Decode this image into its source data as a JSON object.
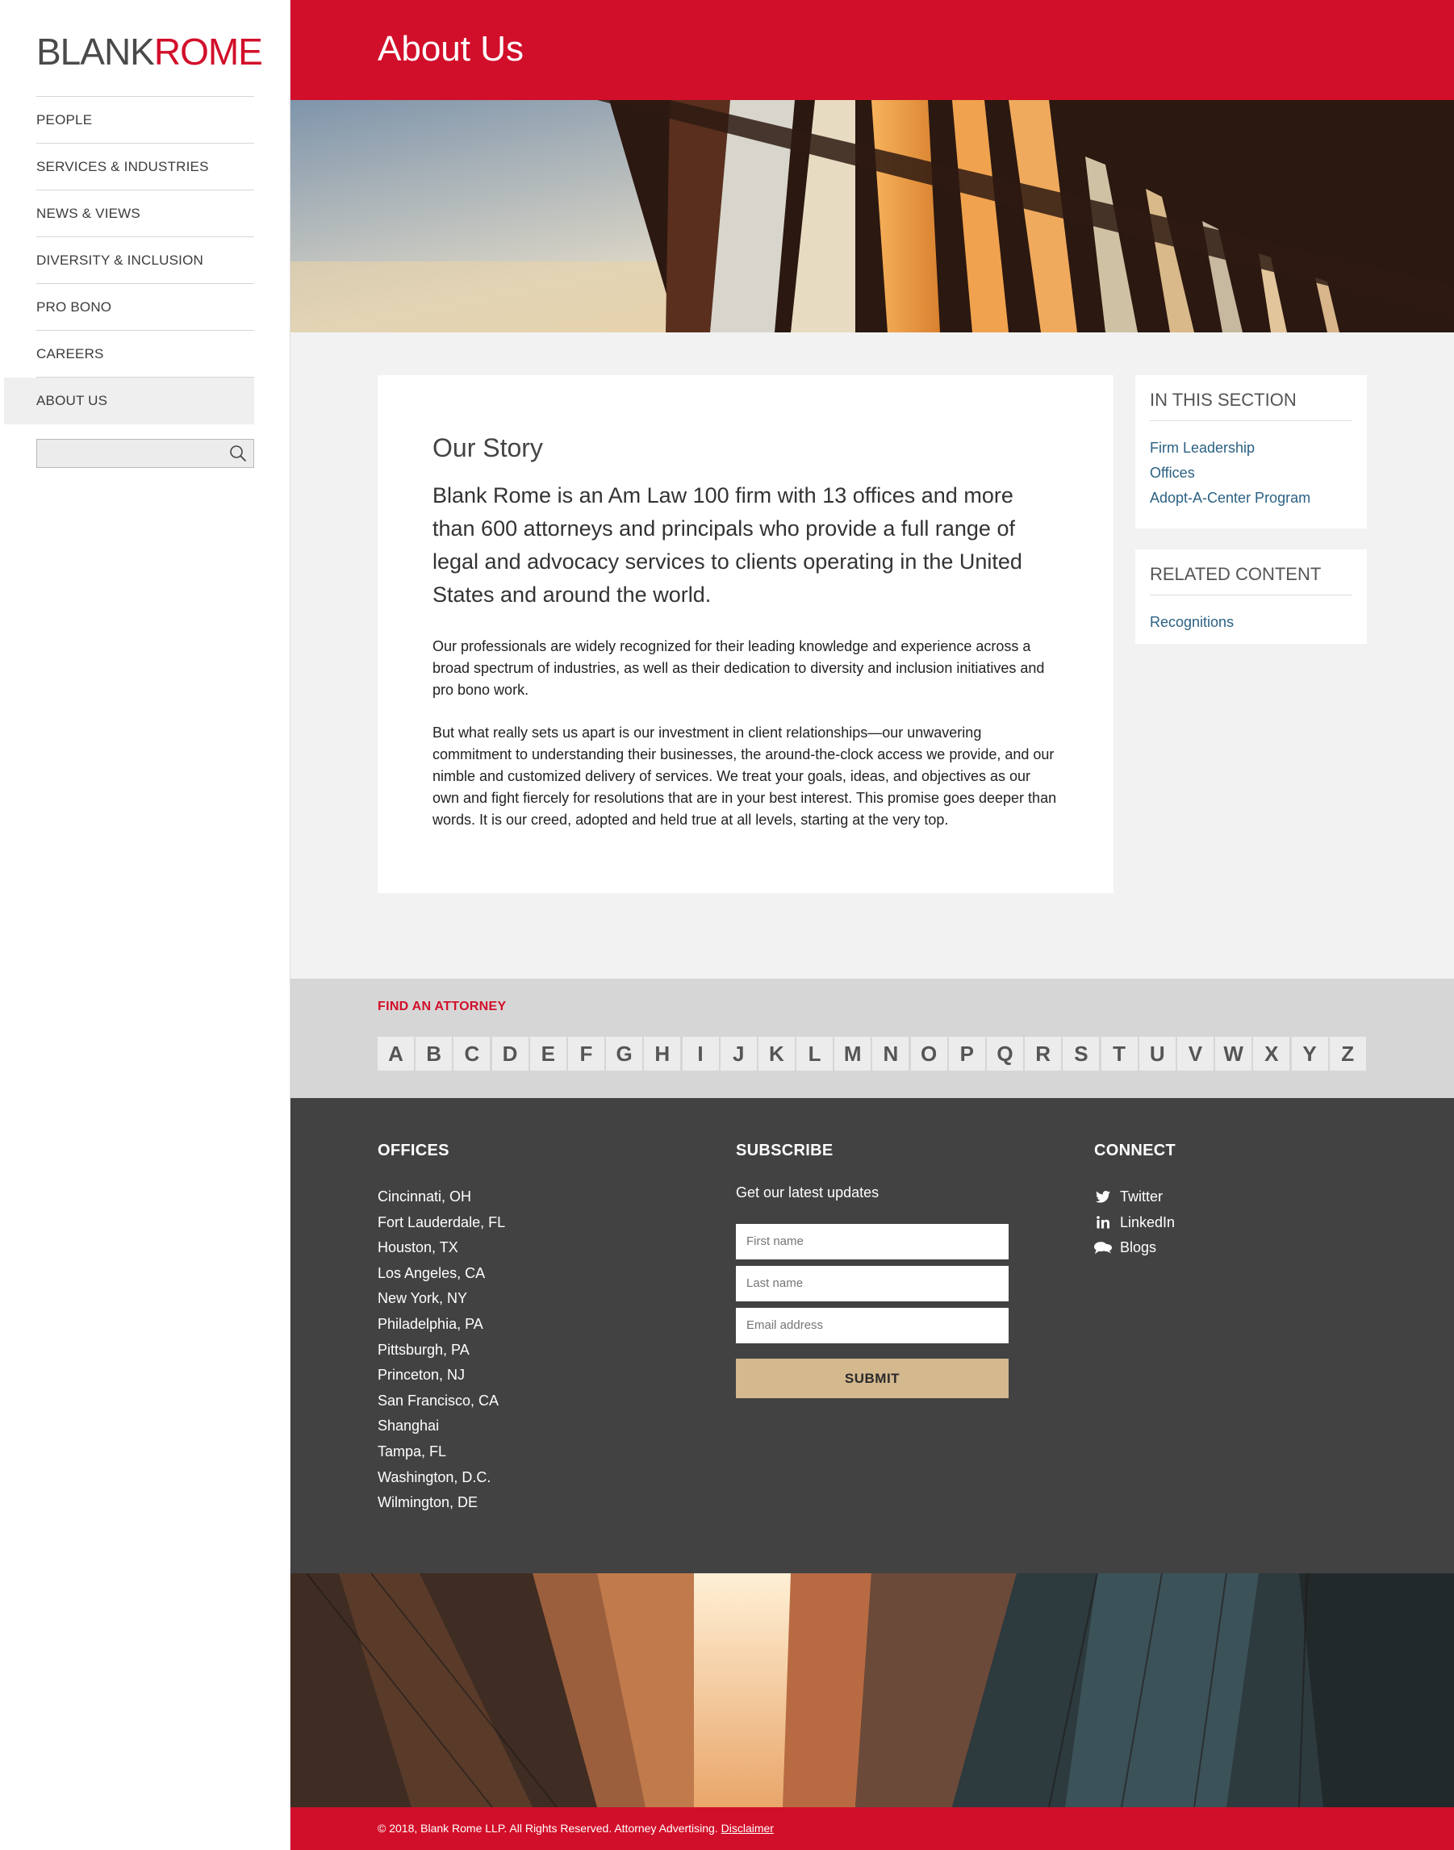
{
  "logo": {
    "blank": "BLANK",
    "rome": "ROME"
  },
  "nav": {
    "items": [
      {
        "label": "PEOPLE"
      },
      {
        "label": "SERVICES & INDUSTRIES"
      },
      {
        "label": "NEWS & VIEWS"
      },
      {
        "label": "DIVERSITY & INCLUSION"
      },
      {
        "label": "PRO BONO"
      },
      {
        "label": "CAREERS"
      },
      {
        "label": "ABOUT US"
      }
    ],
    "active": "ABOUT US"
  },
  "search": {
    "placeholder": "",
    "icon": "search-icon"
  },
  "header": {
    "title": "About Us"
  },
  "story": {
    "heading": "Our Story",
    "lead": "Blank Rome is an Am Law 100 firm with 13 offices and more than 600 attorneys and principals who provide a full range of legal and advocacy services to clients operating in the United States and around the world.",
    "paragraph1": "Our professionals are widely recognized for their leading knowledge and experience across a broad spectrum of industries, as well as their dedication to diversity and inclusion initiatives and pro bono work.",
    "paragraph2": "But what really sets us apart is our investment in client relationships—our unwavering commitment to understanding their businesses, the around-the-clock access we provide, and our nimble and customized delivery of services. We treat your goals, ideas, and objectives as our own and fight fiercely for resolutions that are in your best interest. This promise goes deeper than words. It is our creed, adopted and held true at all levels, starting at the very top."
  },
  "in_section": {
    "title": "IN THIS SECTION",
    "links": [
      "Firm Leadership",
      "Offices",
      "Adopt-A-Center Program"
    ]
  },
  "related": {
    "title": "RELATED CONTENT",
    "links": [
      "Recognitions"
    ]
  },
  "find_attorney": {
    "title": "FIND AN ATTORNEY",
    "letters": [
      "A",
      "B",
      "C",
      "D",
      "E",
      "F",
      "G",
      "H",
      "I",
      "J",
      "K",
      "L",
      "M",
      "N",
      "O",
      "P",
      "Q",
      "R",
      "S",
      "T",
      "U",
      "V",
      "W",
      "X",
      "Y",
      "Z"
    ]
  },
  "footer": {
    "offices": {
      "title": "OFFICES",
      "list": [
        "Cincinnati, OH",
        "Fort Lauderdale, FL",
        "Houston, TX",
        "Los Angeles, CA",
        "New York, NY",
        "Philadelphia, PA",
        "Pittsburgh, PA",
        "Princeton, NJ",
        "San Francisco, CA",
        "Shanghai",
        "Tampa, FL",
        "Washington, D.C.",
        "Wilmington, DE"
      ]
    },
    "subscribe": {
      "title": "SUBSCRIBE",
      "text": "Get our latest updates",
      "first_name_placeholder": "First name",
      "last_name_placeholder": "Last name",
      "email_placeholder": "Email address",
      "submit_label": "SUBMIT"
    },
    "connect": {
      "title": "CONNECT",
      "items": [
        {
          "label": "Twitter",
          "icon": "twitter-icon"
        },
        {
          "label": "LinkedIn",
          "icon": "linkedin-icon"
        },
        {
          "label": "Blogs",
          "icon": "speech-bubbles-icon"
        }
      ]
    }
  },
  "copyright": {
    "text": "© 2018, Blank Rome LLP. All Rights Reserved. Attorney Advertising.",
    "disclaimer": "Disclaimer"
  },
  "colors": {
    "brand_red": "#d20f2a",
    "link_blue": "#2b6183",
    "footer_dark": "#424242",
    "submit_tan": "#d4b88e"
  }
}
